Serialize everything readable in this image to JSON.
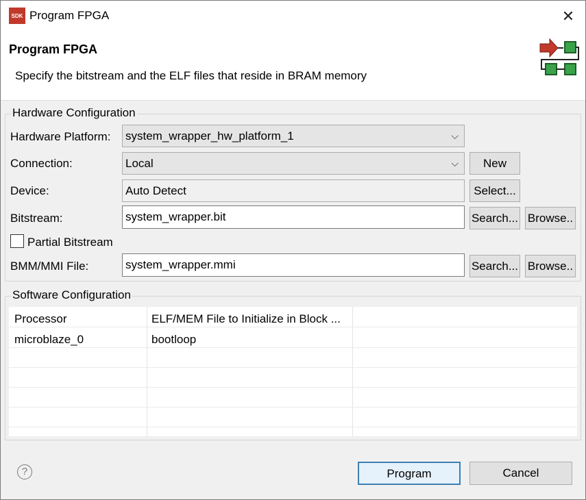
{
  "window": {
    "title": "Program FPGA",
    "app_icon_text": "SDK"
  },
  "banner": {
    "title": "Program FPGA",
    "description": "Specify the bitstream and the ELF files that reside in BRAM memory"
  },
  "hardware": {
    "group_title": "Hardware Configuration",
    "platform_label": "Hardware Platform:",
    "platform_value": "system_wrapper_hw_platform_1",
    "connection_label": "Connection:",
    "connection_value": "Local",
    "new_button": "New",
    "device_label": "Device:",
    "device_value": "Auto Detect",
    "select_button": "Select...",
    "bitstream_label": "Bitstream:",
    "bitstream_value": "system_wrapper.bit",
    "search_button": "Search...",
    "browse_button": "Browse..",
    "partial_label": "Partial Bitstream",
    "partial_checked": false,
    "bmm_label": "BMM/MMI File:",
    "bmm_value": "system_wrapper.mmi"
  },
  "software": {
    "group_title": "Software Configuration",
    "columns": [
      "Processor",
      "ELF/MEM File to Initialize in Block ..."
    ],
    "rows": [
      [
        "microblaze_0",
        "bootloop"
      ]
    ]
  },
  "footer": {
    "help_icon": "?",
    "program_button": "Program",
    "cancel_button": "Cancel"
  }
}
